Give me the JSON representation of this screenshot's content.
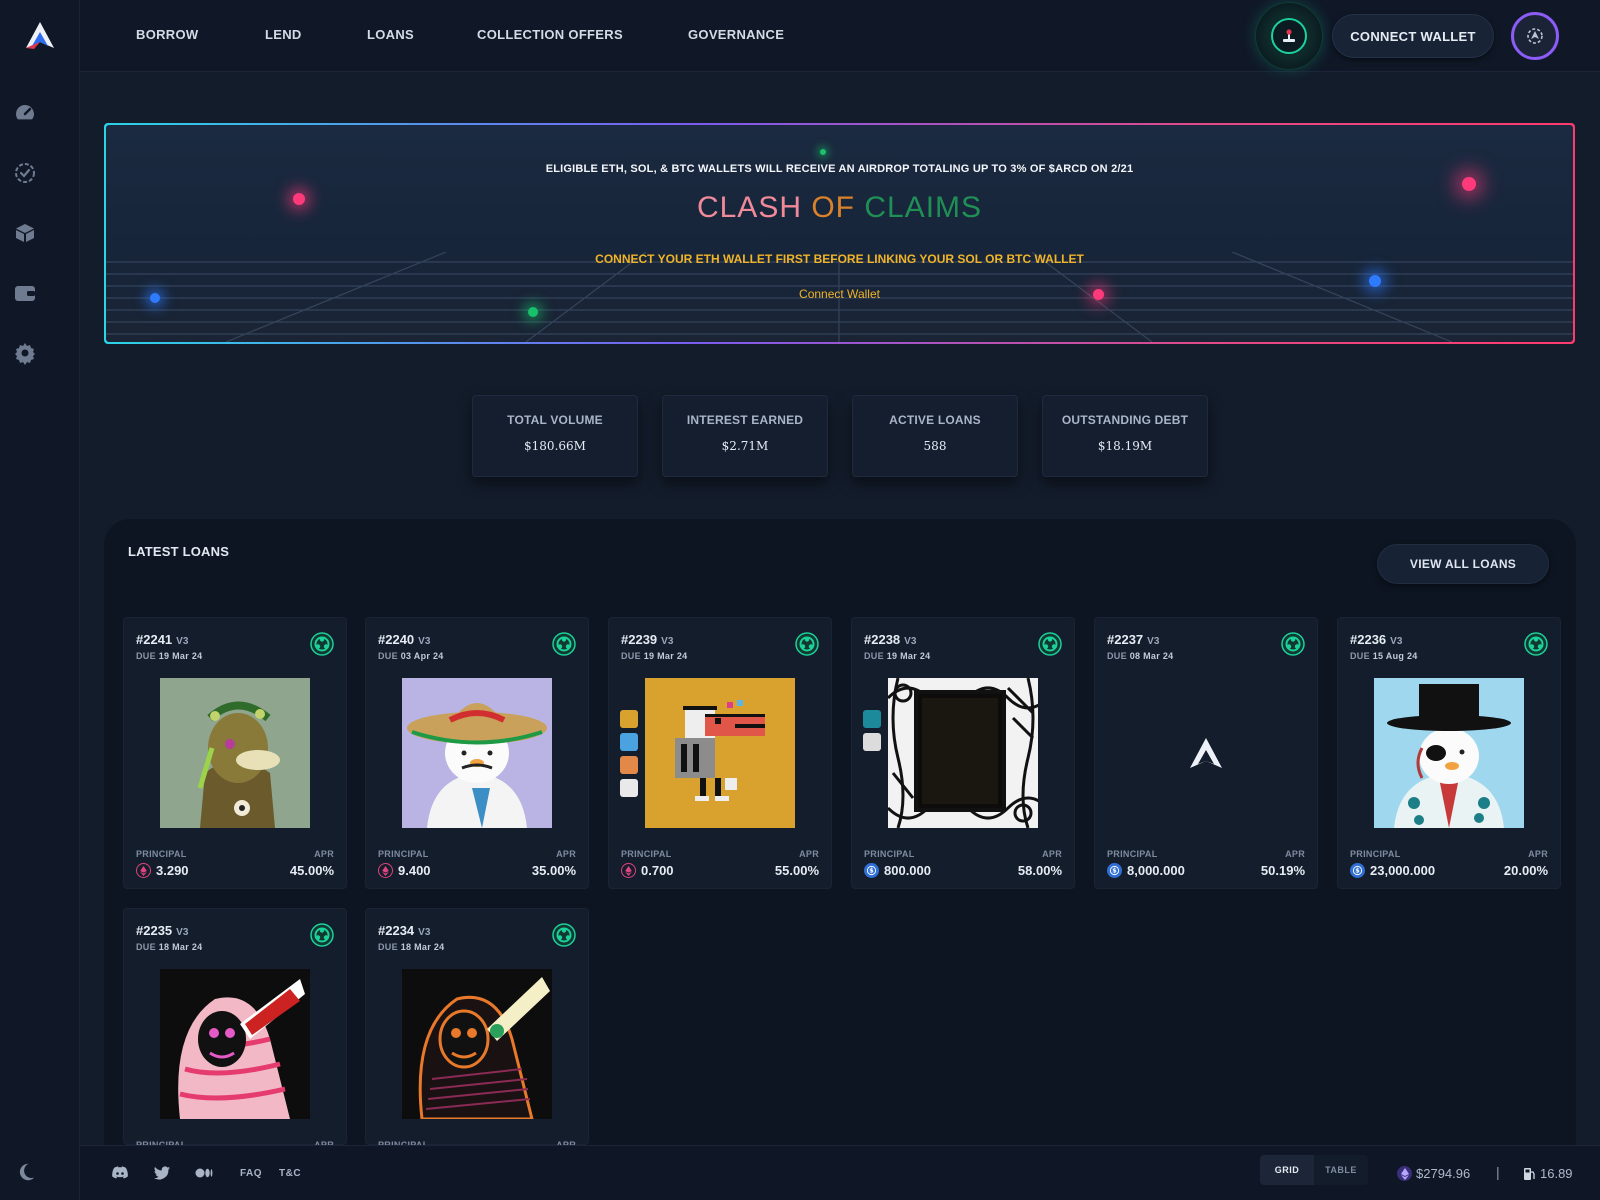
{
  "nav": {
    "items": [
      "BORROW",
      "LEND",
      "LOANS",
      "COLLECTION OFFERS",
      "GOVERNANCE"
    ],
    "connect_wallet": "CONNECT WALLET"
  },
  "sidebar": {
    "icons": [
      "dashboard-gauge-icon",
      "check-circle-icon",
      "box-icon",
      "wallet-icon",
      "settings-gear-icon"
    ],
    "theme_icon": "moon-icon"
  },
  "banner": {
    "top_text": "ELIGIBLE ETH, SOL, & BTC WALLETS WILL RECEIVE AN AIRDROP TOTALING UP TO 3% OF $ARCD ON 2/21",
    "title_parts": [
      "CLASH ",
      "OF ",
      "CLAIMS"
    ],
    "title_colors": [
      "#f08a9a",
      "#d9822b",
      "#1f8f55"
    ],
    "warning": "CONNECT YOUR ETH WALLET FIRST BEFORE LINKING YOUR SOL OR BTC WALLET",
    "link": "Connect Wallet"
  },
  "stats": [
    {
      "label": "TOTAL VOLUME",
      "value": "$180.66M"
    },
    {
      "label": "INTEREST EARNED",
      "value": "$2.71M"
    },
    {
      "label": "ACTIVE LOANS",
      "value": "588"
    },
    {
      "label": "OUTSTANDING DEBT",
      "value": "$18.19M"
    }
  ],
  "loans": {
    "title": "LATEST LOANS",
    "view_all": "VIEW ALL LOANS",
    "principal_label": "PRINCIPAL",
    "apr_label": "APR",
    "due_prefix": "DUE",
    "version": "V3",
    "items": [
      {
        "id": "#2241",
        "due": "19 Mar 24",
        "principal": "3.290",
        "apr": "45.00%",
        "currency": "eth",
        "art": "ape"
      },
      {
        "id": "#2240",
        "due": "03 Apr 24",
        "principal": "9.400",
        "apr": "35.00%",
        "currency": "eth",
        "art": "penguin-sombrero"
      },
      {
        "id": "#2239",
        "due": "19 Mar 24",
        "principal": "0.700",
        "apr": "55.00%",
        "currency": "eth",
        "art": "pixel-bird"
      },
      {
        "id": "#2238",
        "due": "19 Mar 24",
        "principal": "800.000",
        "apr": "58.00%",
        "currency": "usdc",
        "art": "pattern-frame"
      },
      {
        "id": "#2237",
        "due": "08 Mar 24",
        "principal": "8,000.000",
        "apr": "50.19%",
        "currency": "usdc",
        "art": "arcade-logo"
      },
      {
        "id": "#2236",
        "due": "15 Aug 24",
        "principal": "23,000.000",
        "apr": "20.00%",
        "currency": "usdc",
        "art": "penguin-tophat"
      },
      {
        "id": "#2235",
        "due": "18 Mar 24",
        "principal": "",
        "apr": "",
        "currency": "eth",
        "art": "hoodie-pink"
      },
      {
        "id": "#2234",
        "due": "18 Mar 24",
        "principal": "",
        "apr": "",
        "currency": "eth",
        "art": "hoodie-orange"
      }
    ]
  },
  "footer": {
    "links": [
      "FAQ",
      "T&C"
    ],
    "icons": [
      "discord-icon",
      "twitter-icon",
      "medium-icon"
    ],
    "view_toggle": [
      "GRID",
      "TABLE"
    ],
    "eth_price": "$2794.96",
    "separator": "|",
    "gas": "16.89"
  },
  "colors": {
    "background": "#131c2b",
    "accent_green": "#1bd19c",
    "accent_purple": "#8b5cf6",
    "warning_yellow": "#f0b429"
  }
}
